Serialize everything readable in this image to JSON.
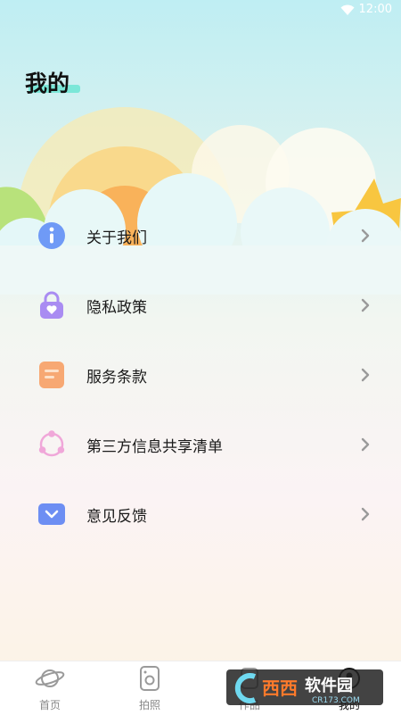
{
  "status_bar": {
    "time": "12:00"
  },
  "page": {
    "title": "我的"
  },
  "menu": {
    "items": [
      {
        "label": "关于我们",
        "icon": "info-icon"
      },
      {
        "label": "隐私政策",
        "icon": "lock-heart-icon"
      },
      {
        "label": "服务条款",
        "icon": "document-icon"
      },
      {
        "label": "第三方信息共享清单",
        "icon": "share-icon"
      },
      {
        "label": "意见反馈",
        "icon": "feedback-icon"
      }
    ]
  },
  "nav": {
    "items": [
      {
        "label": "首页",
        "icon": "planet-icon"
      },
      {
        "label": "拍照",
        "icon": "camera-icon"
      },
      {
        "label": "作品",
        "icon": "works-icon"
      },
      {
        "label": "我的",
        "icon": "profile-icon",
        "active": true
      }
    ]
  },
  "watermark": {
    "brand": "西西",
    "text": "软件园",
    "url": "CR173.COM"
  },
  "colors": {
    "accent": "#7be7d8",
    "info": "#6f9af6",
    "lock": "#a98cf2",
    "doc": "#f7a873",
    "share": "#f0a7d9",
    "feedback": "#6d8ef3"
  }
}
